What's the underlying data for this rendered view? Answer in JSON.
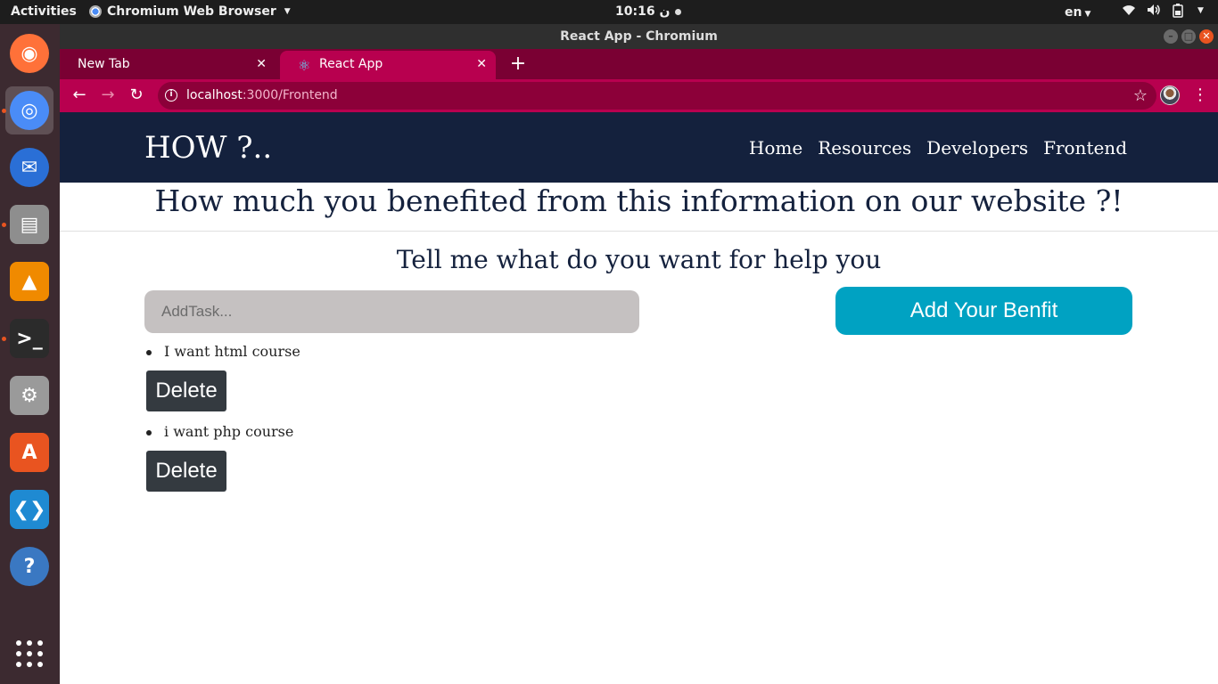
{
  "system": {
    "activities": "Activities",
    "app_name": "Chromium Web Browser",
    "clock": "10:16 ن",
    "lang": "en"
  },
  "dock": {
    "apps": [
      {
        "name": "firefox",
        "running": false,
        "active": false,
        "color": "#ff7139"
      },
      {
        "name": "chromium",
        "running": true,
        "active": true,
        "color": "#4a8cf7"
      },
      {
        "name": "thunderbird",
        "running": false,
        "active": false,
        "color": "#2a6fd6"
      },
      {
        "name": "files",
        "running": true,
        "active": false,
        "color": "#8e8e8e"
      },
      {
        "name": "vlc",
        "running": false,
        "active": false,
        "color": "#f08a00"
      },
      {
        "name": "terminal",
        "running": true,
        "active": false,
        "color": "#2b2b2b"
      },
      {
        "name": "settings",
        "running": false,
        "active": false,
        "color": "#9a9a9a"
      },
      {
        "name": "software",
        "running": false,
        "active": false,
        "color": "#e95420"
      },
      {
        "name": "vscode",
        "running": false,
        "active": false,
        "color": "#1f8ad2"
      },
      {
        "name": "help",
        "running": false,
        "active": false,
        "color": "#3a78c2"
      }
    ]
  },
  "browser": {
    "window_title": "React App - Chromium",
    "tabs": [
      {
        "label": "New Tab",
        "active": false
      },
      {
        "label": "React App",
        "active": true
      }
    ],
    "url_host": "localhost",
    "url_path": ":3000/Frontend"
  },
  "site": {
    "brand": "HOW ?..",
    "nav": [
      "Home",
      "Resources",
      "Developers",
      "Frontend"
    ],
    "headline": "How much you benefited from this information on our website ?!",
    "subhead": "Tell me what do you want for help you",
    "input_placeholder": "AddTask...",
    "input_value": "",
    "add_button": "Add Your Benfit",
    "tasks": [
      {
        "text": "I want html course",
        "delete_label": "Delete"
      },
      {
        "text": "i want php course",
        "delete_label": "Delete"
      }
    ]
  },
  "colors": {
    "navbar_bg": "#14213d",
    "add_button_bg": "#00a2c2",
    "delete_button_bg": "#343a40",
    "input_bg": "#c5c1c1",
    "browser_accent": "#b8004f"
  }
}
